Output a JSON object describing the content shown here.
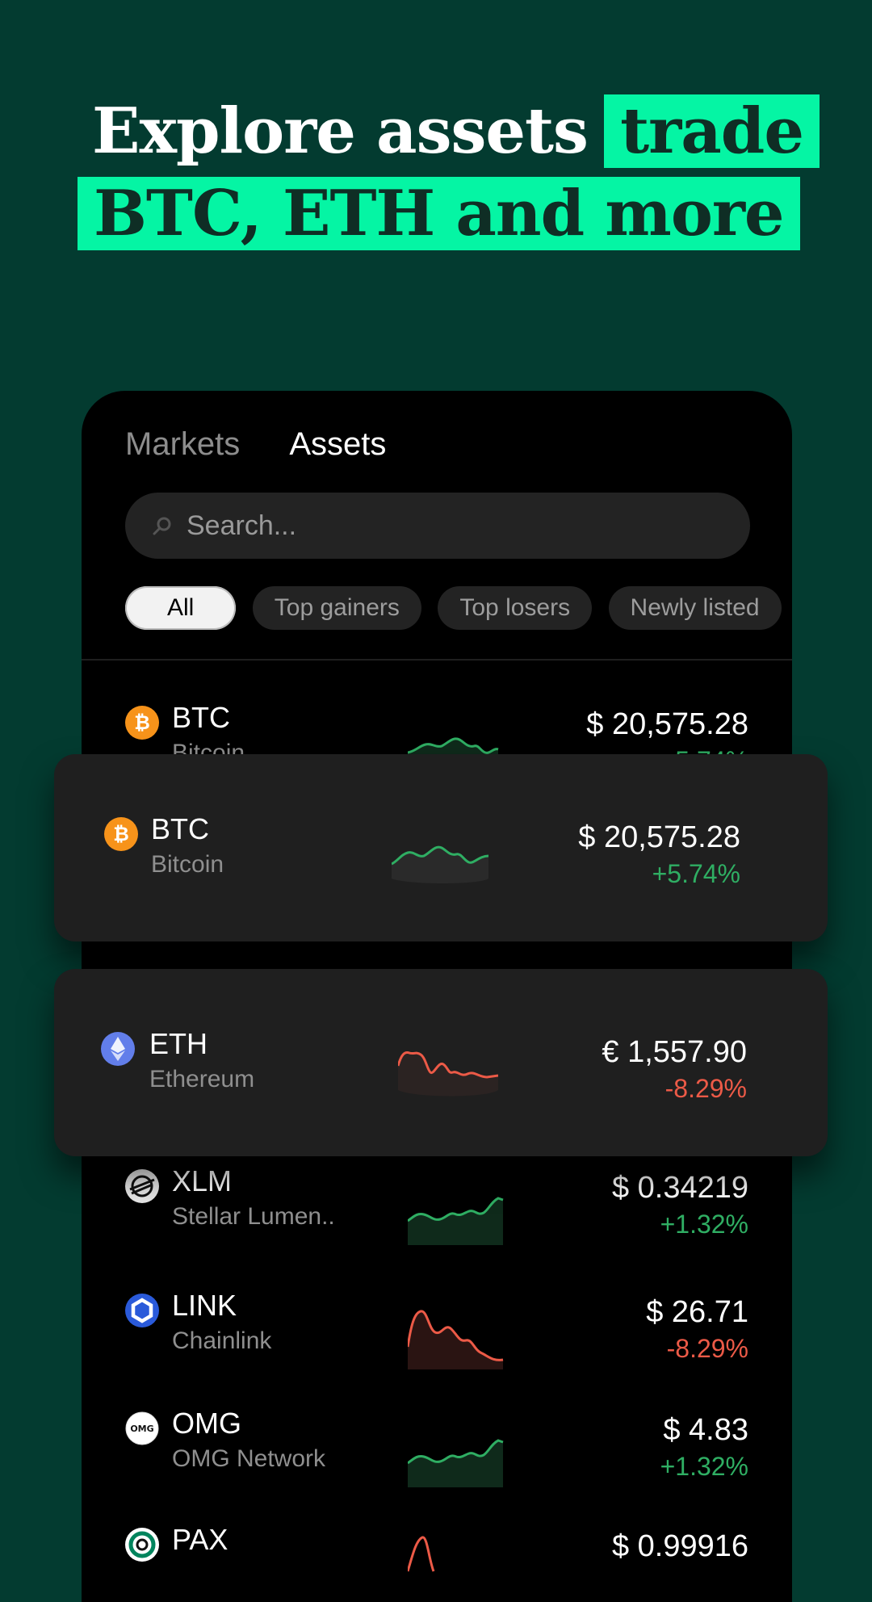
{
  "headline": {
    "line1_plain": "Explore assets",
    "line1_highlight": "trade",
    "line2_highlight": "BTC, ETH and more"
  },
  "tabs": [
    {
      "label": "Markets",
      "active": false
    },
    {
      "label": "Assets",
      "active": true
    }
  ],
  "search": {
    "placeholder": "Search..."
  },
  "filters": [
    {
      "label": "All",
      "active": true
    },
    {
      "label": "Top gainers",
      "active": false
    },
    {
      "label": "Top losers",
      "active": false
    },
    {
      "label": "Newly listed",
      "active": false
    }
  ],
  "assets": [
    {
      "symbol": "BTC",
      "name": "Bitcoin",
      "price": "$ 20,575.28",
      "change": "+5.74%",
      "trend": "up",
      "icon": "bitcoin-icon"
    },
    {
      "symbol": "BTC",
      "name": "Bitcoin",
      "price": "$ 20,575.28",
      "change": "+5.74%",
      "trend": "up",
      "icon": "bitcoin-icon"
    },
    {
      "symbol": "ETH",
      "name": "Ethereum",
      "price": "€ 1,557.90",
      "change": "-8.29%",
      "trend": "down",
      "icon": "ethereum-icon"
    },
    {
      "symbol": "XLM",
      "name": "Stellar Lumen..",
      "price": "$ 0.34219",
      "change": "+1.32%",
      "trend": "up",
      "icon": "stellar-icon"
    },
    {
      "symbol": "LINK",
      "name": "Chainlink",
      "price": "$ 26.71",
      "change": "-8.29%",
      "trend": "down",
      "icon": "chainlink-icon"
    },
    {
      "symbol": "OMG",
      "name": "OMG Network",
      "price": "$ 4.83",
      "change": "+1.32%",
      "trend": "up",
      "icon": "omg-icon"
    },
    {
      "symbol": "PAX",
      "name": "",
      "price": "$ 0.99916",
      "change": "",
      "trend": "down",
      "icon": "pax-icon"
    }
  ],
  "colors": {
    "background": "#033b30",
    "highlight": "#05f5a4",
    "positive": "#2fae63",
    "negative": "#ec5a47"
  },
  "icons": {
    "bitcoin": "bitcoin-icon",
    "ethereum": "ethereum-icon",
    "stellar": "stellar-icon",
    "chainlink": "chainlink-icon",
    "omg": "omg-icon",
    "pax": "pax-icon",
    "search": "search-icon"
  },
  "icon_text": {
    "omg": "OMG"
  }
}
